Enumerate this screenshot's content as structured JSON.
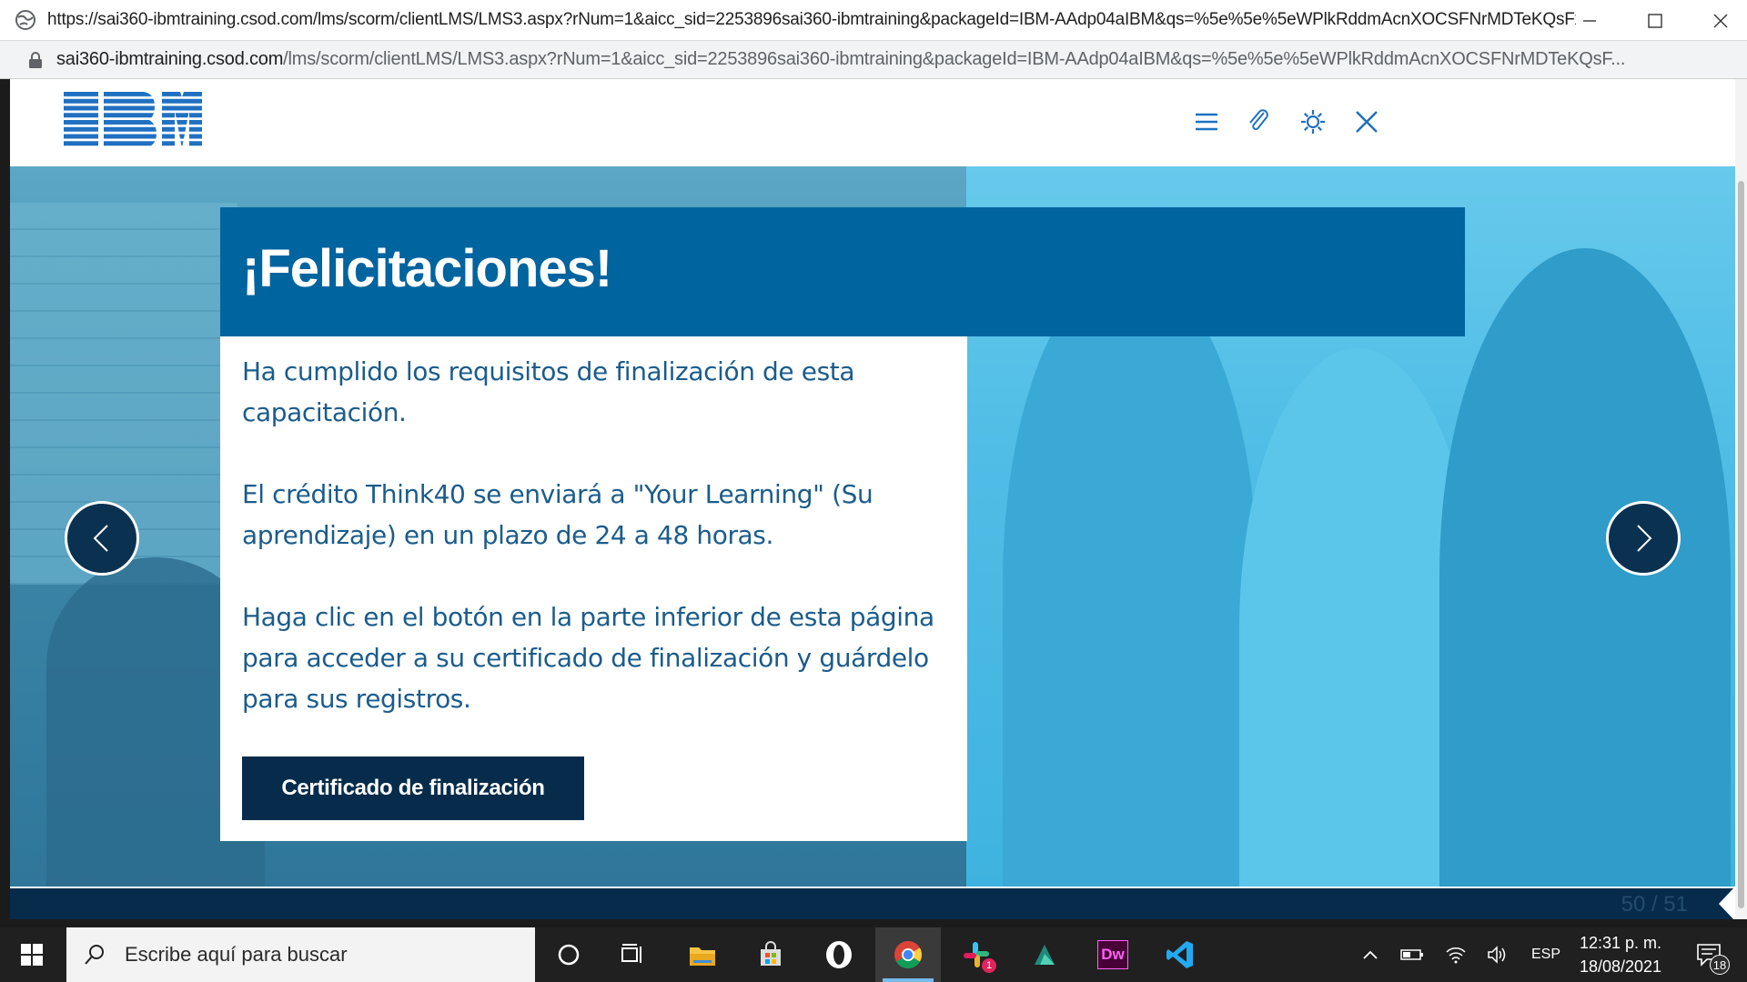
{
  "window": {
    "title": "https://sai360-ibmtraining.csod.com/lms/scorm/clientLMS/LMS3.aspx?rNum=1&aicc_sid=2253896sai360-ibmtraining&packageId=IBM-AAdp04aIBM&qs=%5e%5e%5eWPlkRddmAcnXOCSFNrMDTeKQsFx7Fi..."
  },
  "address_bar": {
    "host": "sai360-ibmtraining.csod.com",
    "path": "/lms/scorm/clientLMS/LMS3.aspx?rNum=1&aicc_sid=2253896sai360-ibmtraining&packageId=IBM-AAdp04aIBM&qs=%5e%5e%5eWPlkRddmAcnXOCSFNrMDTeKQsF..."
  },
  "header": {
    "logo_text": "IBM",
    "icons": [
      "menu-icon",
      "paperclip-icon",
      "settings-icon",
      "close-icon"
    ]
  },
  "slide": {
    "heading": "¡Felicitaciones!",
    "paragraph_1": "Ha cumplido los requisitos de finalización de esta capacitación.",
    "paragraph_2": "El crédito Think40 se enviará a \"Your Learning\" (Su aprendizaje) en un plazo de 24 a 48 horas.",
    "paragraph_3": "Haga clic en el botón en la parte inferior de esta página para acceder a su certificado de finalización y guárdelo para sus registros.",
    "button_label": "Certificado de finalización"
  },
  "footer": {
    "pager": "50 / 51"
  },
  "taskbar": {
    "search_placeholder": "Escribe aquí para buscar",
    "apps": [
      "cortana-icon",
      "task-view-icon",
      "file-explorer-icon",
      "store-icon",
      "opera-icon",
      "chrome-icon",
      "slack-icon",
      "app-icon",
      "dreamweaver-icon",
      "vscode-icon"
    ],
    "dw_label": "Dw",
    "slack_badge": "1",
    "language": "ESP",
    "time": "12:31 p. m.",
    "date": "18/08/2021",
    "notifications_count": "18",
    "colors": {
      "taskbar": "#202020",
      "accent": "#76b9ed"
    }
  },
  "colors": {
    "heading_bg": "#00649f",
    "body_text": "#1b5c8c",
    "button_bg": "#072c4b",
    "photo_tint": "#4fbde6"
  }
}
